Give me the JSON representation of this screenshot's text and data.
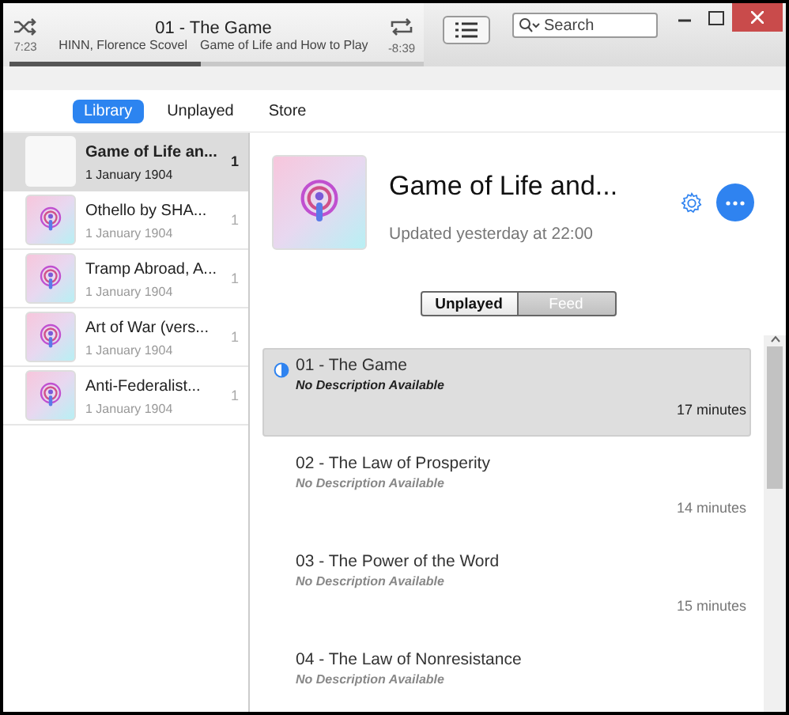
{
  "player": {
    "track_title": "01 - The Game",
    "artist": "HINN,  Florence Scovel",
    "album": "Game of Life and How to Play",
    "elapsed": "7:23",
    "remaining": "-8:39",
    "level": 0.46,
    "shuffle": true,
    "repeat": true
  },
  "search": {
    "placeholder": "Search"
  },
  "tabs": [
    {
      "label": "Library",
      "selected": true
    },
    {
      "label": "Unplayed",
      "selected": false
    },
    {
      "label": "Store",
      "selected": false
    }
  ],
  "sidebar": {
    "items": [
      {
        "title": "Game of Life an...",
        "date": "1 January 1904",
        "count": "1",
        "selected": true,
        "kind": "blank"
      },
      {
        "title": "Othello by SHA...",
        "date": "1 January 1904",
        "count": "1",
        "selected": false,
        "kind": "podcast"
      },
      {
        "title": "Tramp Abroad, A...",
        "date": "1 January 1904",
        "count": "1",
        "selected": false,
        "kind": "podcast"
      },
      {
        "title": "Art of War (vers...",
        "date": "1 January 1904",
        "count": "1",
        "selected": false,
        "kind": "podcast"
      },
      {
        "title": "Anti-Federalist...",
        "date": "1 January 1904",
        "count": "1",
        "selected": false,
        "kind": "podcast"
      }
    ]
  },
  "podcast": {
    "title": "Game of Life and...",
    "updated": "Updated yesterday at 22:00"
  },
  "view_toggle": [
    {
      "label": "Unplayed",
      "selected": true
    },
    {
      "label": "Feed",
      "selected": false
    }
  ],
  "episodes": [
    {
      "title": "01 - The Game",
      "description": "No Description Available",
      "duration": "17 minutes",
      "selected": true,
      "in_progress": true
    },
    {
      "title": "02 - The Law of Prosperity",
      "description": "No Description Available",
      "duration": "14 minutes",
      "selected": false,
      "in_progress": false
    },
    {
      "title": "03 - The Power of the Word",
      "description": "No Description Available",
      "duration": "15 minutes",
      "selected": false,
      "in_progress": false
    },
    {
      "title": "04 - The Law of Nonresistance",
      "description": "No Description Available",
      "selected": false,
      "in_progress": false
    }
  ]
}
